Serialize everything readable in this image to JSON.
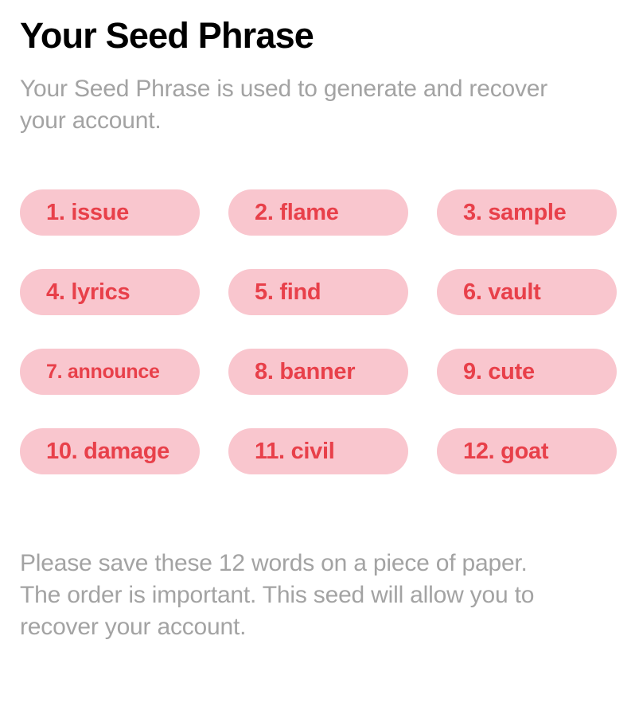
{
  "screen": {
    "title": "Your Seed Phrase",
    "subtitle": "Your Seed Phrase is used to generate and recover your account.",
    "footer_note": "Please save these 12 words on a piece of paper. The order is important. This seed will allow you to recover your account."
  },
  "colors": {
    "background": "#ffffff",
    "title_text": "#000000",
    "muted_text": "#a3a3a3",
    "pill_background": "#f9c6ce",
    "pill_text": "#e8404a"
  },
  "seed_phrase": {
    "word_count": 12,
    "columns": 3,
    "rows": 4,
    "words": [
      {
        "index": "1",
        "word": "issue",
        "label": "1. issue"
      },
      {
        "index": "2",
        "word": "flame",
        "label": "2. flame"
      },
      {
        "index": "3",
        "word": "sample",
        "label": "3. sample"
      },
      {
        "index": "4",
        "word": "lyrics",
        "label": "4. lyrics"
      },
      {
        "index": "5",
        "word": "find",
        "label": "5. find"
      },
      {
        "index": "6",
        "word": "vault",
        "label": "6. vault"
      },
      {
        "index": "7",
        "word": "announce",
        "label": "7. announce"
      },
      {
        "index": "8",
        "word": "banner",
        "label": "8. banner"
      },
      {
        "index": "9",
        "word": "cute",
        "label": "9. cute"
      },
      {
        "index": "10",
        "word": "damage",
        "label": "10. damage"
      },
      {
        "index": "11",
        "word": "civil",
        "label": "11. civil"
      },
      {
        "index": "12",
        "word": "goat",
        "label": "12. goat"
      }
    ]
  }
}
